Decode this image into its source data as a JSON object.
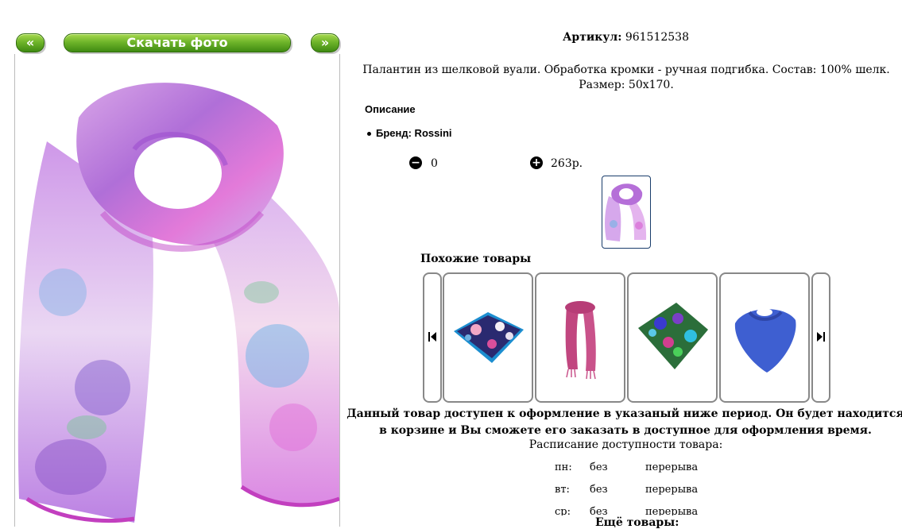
{
  "gallery": {
    "prev_label": "«",
    "download_label": "Скачать фото",
    "next_label": "»"
  },
  "product": {
    "sku_label": "Артикул:",
    "sku_value": "961512538",
    "description": "Палантин из шелковой вуали. Обработка кромки - ручная подгибка. Состав: 100% шелк. Размер: 50x170.",
    "section_title": "Описание",
    "brand_line": "Бренд: Rossini",
    "qty_value": "0",
    "price": "263р."
  },
  "similar": {
    "title": "Похожие товары",
    "items": [
      {
        "name": "scarf-blue-floral"
      },
      {
        "name": "scarf-pink"
      },
      {
        "name": "scarf-green-floral"
      },
      {
        "name": "scarf-blue"
      }
    ]
  },
  "availability": {
    "notice": "Данный товар доступен к оформление в указаный ниже период. Он будет находится в корзине и Вы сможете его заказать в доступное для оформления время.",
    "schedule_title": "Расписание доступности товара:",
    "rows": [
      {
        "day": "пн:",
        "col2": "без",
        "col3": "перерыва"
      },
      {
        "day": "вт:",
        "col2": "без",
        "col3": "перерыва"
      },
      {
        "day": "ср:",
        "col2": "без",
        "col3": "перерыва"
      }
    ]
  },
  "more_label": "Ещё товары:",
  "colors": {
    "button_green": "#6fb52a",
    "thumb_border": "#1a3d6b",
    "carousel_border": "#888888"
  }
}
